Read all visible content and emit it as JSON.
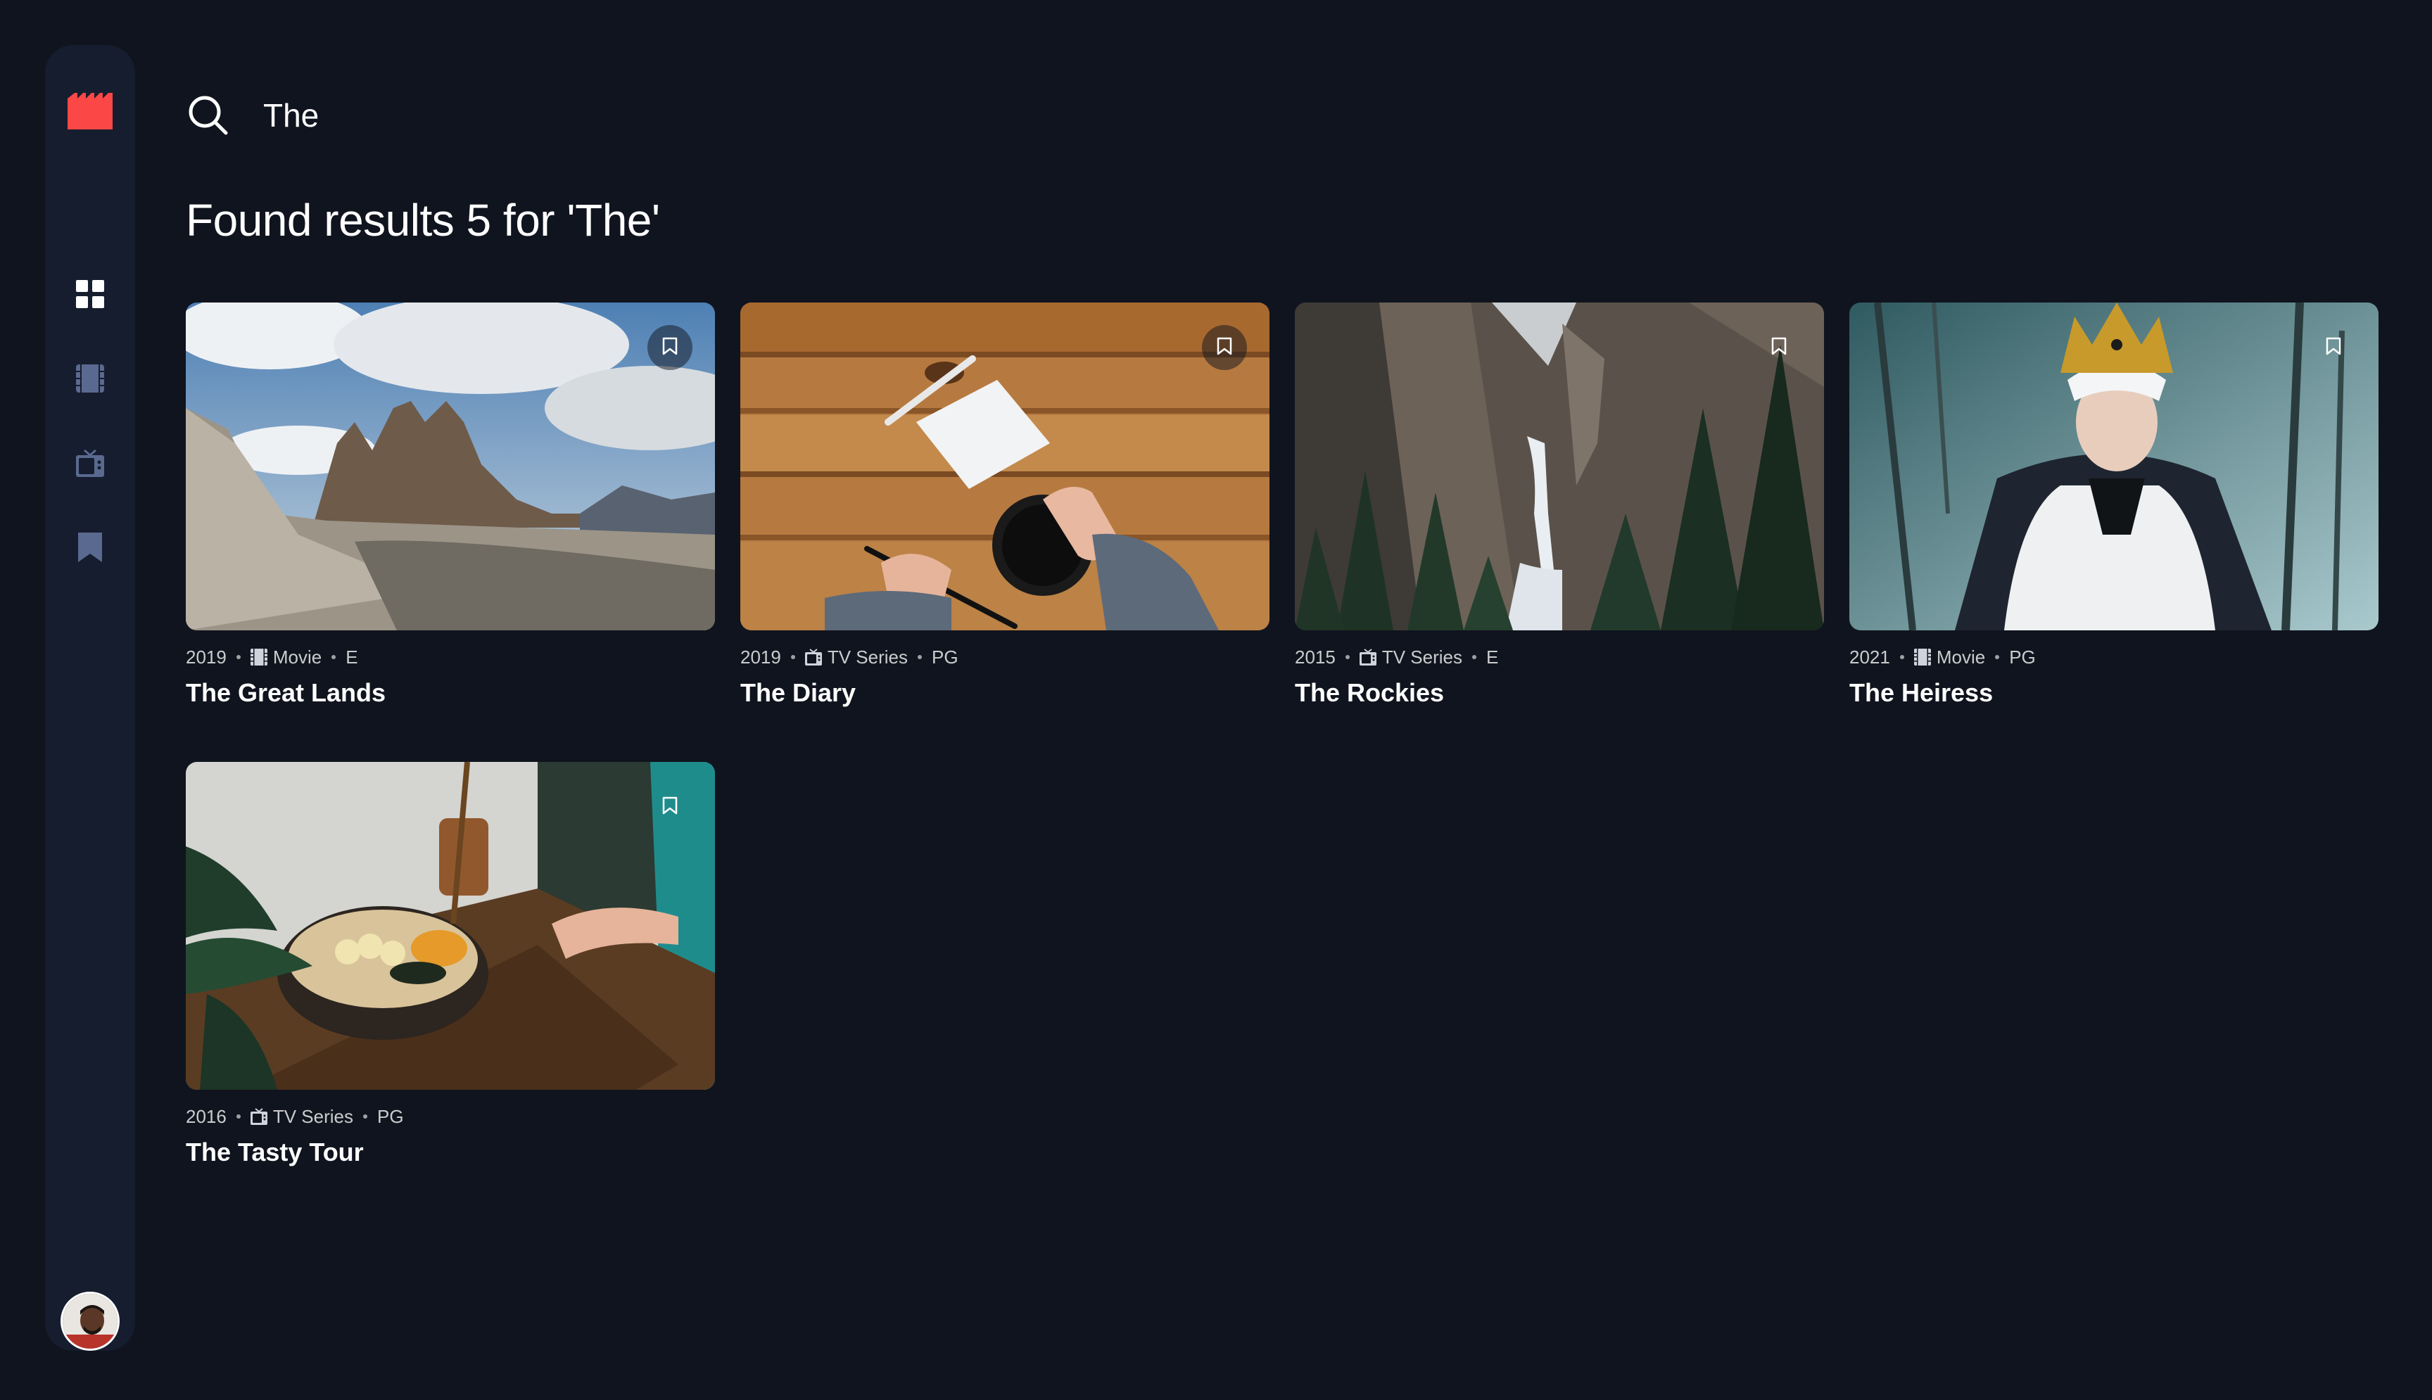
{
  "sidebar": {
    "logo": "film-clapper-icon",
    "nav": [
      {
        "name": "home",
        "icon": "grid-icon",
        "active": true
      },
      {
        "name": "movies",
        "icon": "film-icon",
        "active": false
      },
      {
        "name": "tv-series",
        "icon": "tv-icon",
        "active": false
      },
      {
        "name": "bookmarks",
        "icon": "bookmark-icon",
        "active": false
      }
    ],
    "avatar": "user-avatar"
  },
  "search": {
    "value": "The",
    "icon": "search-icon"
  },
  "results_heading": "Found results 5 for 'The'",
  "results": [
    {
      "year": "2019",
      "category": "Movie",
      "category_icon": "film-icon",
      "rating": "E",
      "title": "The Great Lands",
      "bookmark_style": "circle"
    },
    {
      "year": "2019",
      "category": "TV Series",
      "category_icon": "tv-icon",
      "rating": "PG",
      "title": "The Diary",
      "bookmark_style": "circle"
    },
    {
      "year": "2015",
      "category": "TV Series",
      "category_icon": "tv-icon",
      "rating": "E",
      "title": "The Rockies",
      "bookmark_style": "plain"
    },
    {
      "year": "2021",
      "category": "Movie",
      "category_icon": "film-icon",
      "rating": "PG",
      "title": "The Heiress",
      "bookmark_style": "plain"
    },
    {
      "year": "2016",
      "category": "TV Series",
      "category_icon": "tv-icon",
      "rating": "PG",
      "title": "The Tasty Tour",
      "bookmark_style": "plain"
    }
  ],
  "colors": {
    "background": "#10141e",
    "sidebar": "#161d2f",
    "accent": "#fc4747",
    "icon_inactive": "#5a698f"
  }
}
